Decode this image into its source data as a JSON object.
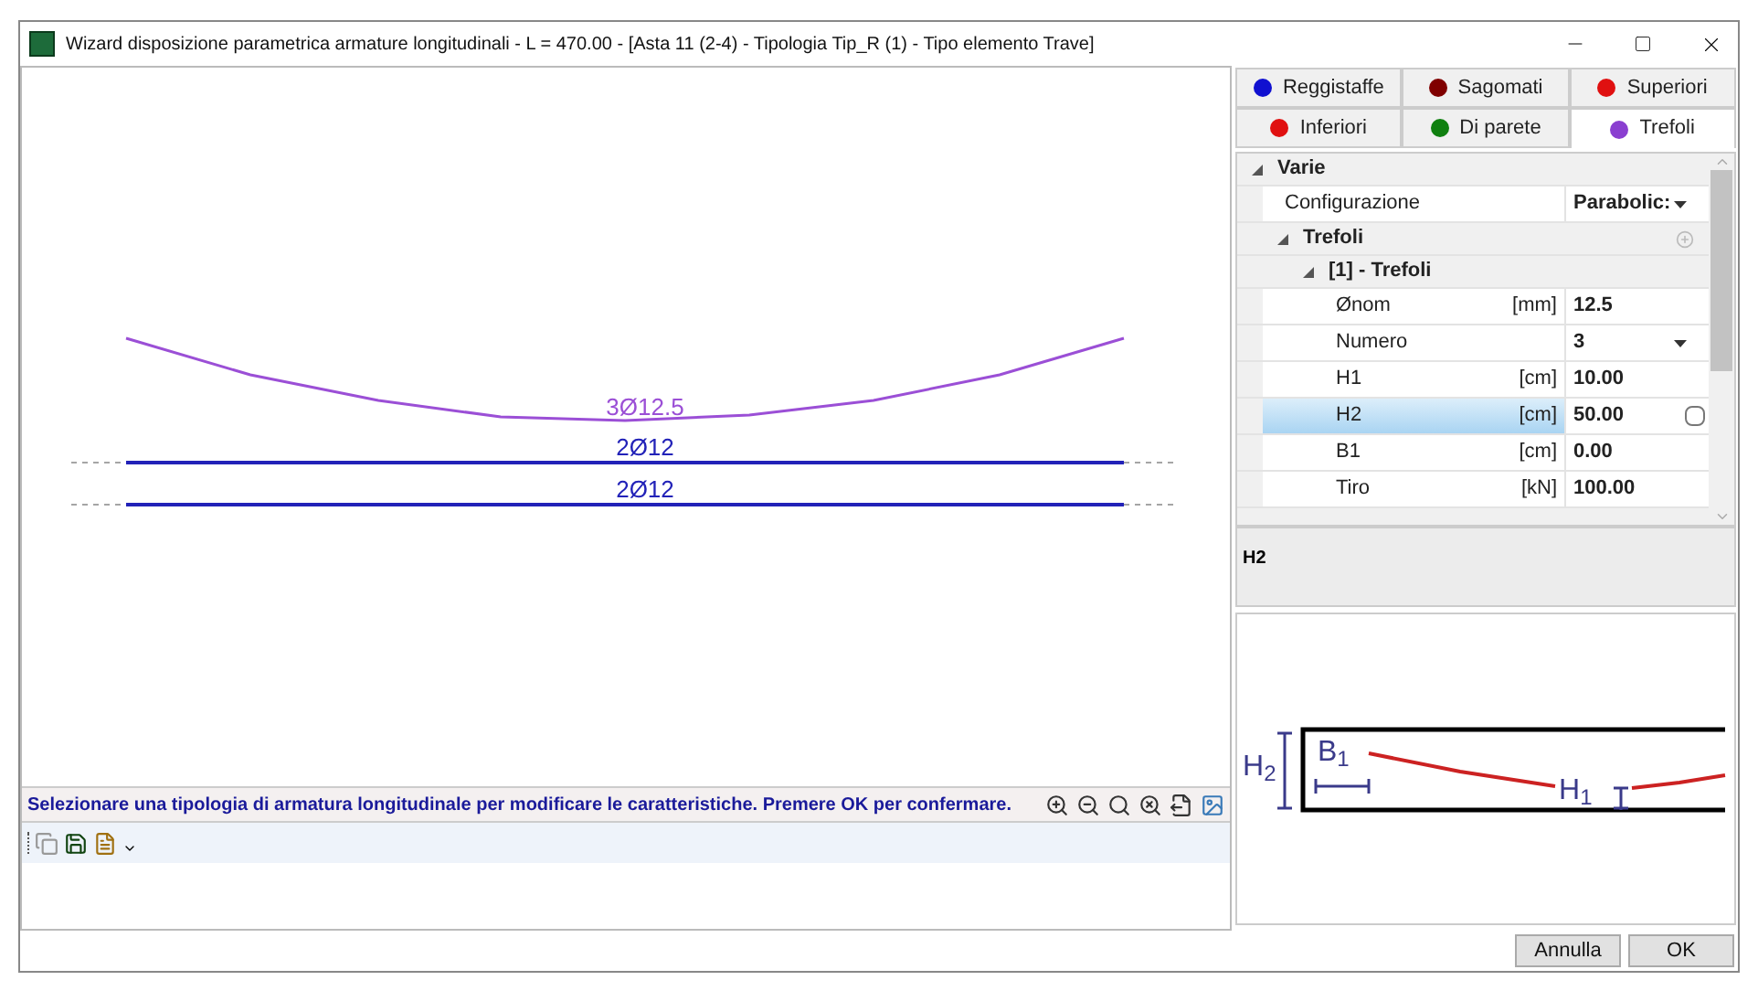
{
  "window": {
    "title": "Wizard disposizione parametrica armature longitudinali - L = 470.00 - [Asta 11 (2-4) - Tipologia Tip_R (1) - Tipo elemento Trave]"
  },
  "canvas": {
    "bars": [
      {
        "kind": "parabola",
        "label": "3Ø12.5",
        "color": "#9b4fd6"
      },
      {
        "kind": "straight",
        "label": "2Ø12",
        "color": "#2222b8"
      },
      {
        "kind": "straight",
        "label": "2Ø12",
        "color": "#2222b8"
      }
    ]
  },
  "message": "Selezionare una tipologia di armatura longitudinale per modificare le caratteristiche. Premere OK per confermare.",
  "tabs": [
    {
      "label": "Reggistaffe",
      "color": "#1010d0",
      "selected": false
    },
    {
      "label": "Sagomati",
      "color": "#800000",
      "selected": false
    },
    {
      "label": "Superiori",
      "color": "#e01010",
      "selected": false
    },
    {
      "label": "Inferiori",
      "color": "#e01010",
      "selected": false
    },
    {
      "label": "Di parete",
      "color": "#108010",
      "selected": false
    },
    {
      "label": "Trefoli",
      "color": "#8a3fd0",
      "selected": true
    }
  ],
  "properties": [
    {
      "kind": "group",
      "label": "Varie",
      "expanded": true,
      "children": [
        {
          "kind": "row",
          "name": "Configurazione",
          "value": "Parabolic:",
          "dropdown": true,
          "selected": false
        },
        {
          "kind": "group",
          "label": "Trefoli",
          "expanded": true,
          "add": true,
          "children": [
            {
              "kind": "group",
              "label": "[1] - Trefoli",
              "expanded": true,
              "children": [
                {
                  "kind": "row",
                  "name": "Ønom",
                  "unit": "[mm]",
                  "value": "12.5",
                  "selected": false
                },
                {
                  "kind": "row",
                  "name": "Numero",
                  "value": "3",
                  "dropdown": true,
                  "selected": false
                },
                {
                  "kind": "row",
                  "name": "H1",
                  "unit": "[cm]",
                  "value": "10.00",
                  "selected": false
                },
                {
                  "kind": "row",
                  "name": "H2",
                  "unit": "[cm]",
                  "value": "50.00",
                  "selected": true,
                  "button": true
                },
                {
                  "kind": "row",
                  "name": "B1",
                  "unit": "[cm]",
                  "value": "0.00",
                  "selected": false
                },
                {
                  "kind": "row",
                  "name": "Tiro",
                  "unit": "[kN]",
                  "value": "100.00",
                  "selected": false
                }
              ]
            }
          ]
        }
      ]
    }
  ],
  "description": {
    "title": "H2"
  },
  "diagram": {
    "labels": [
      "H$_{2}$",
      "B$_{1}$",
      "H$_{1}$"
    ]
  },
  "buttons": [
    "Annulla",
    "OK"
  ]
}
